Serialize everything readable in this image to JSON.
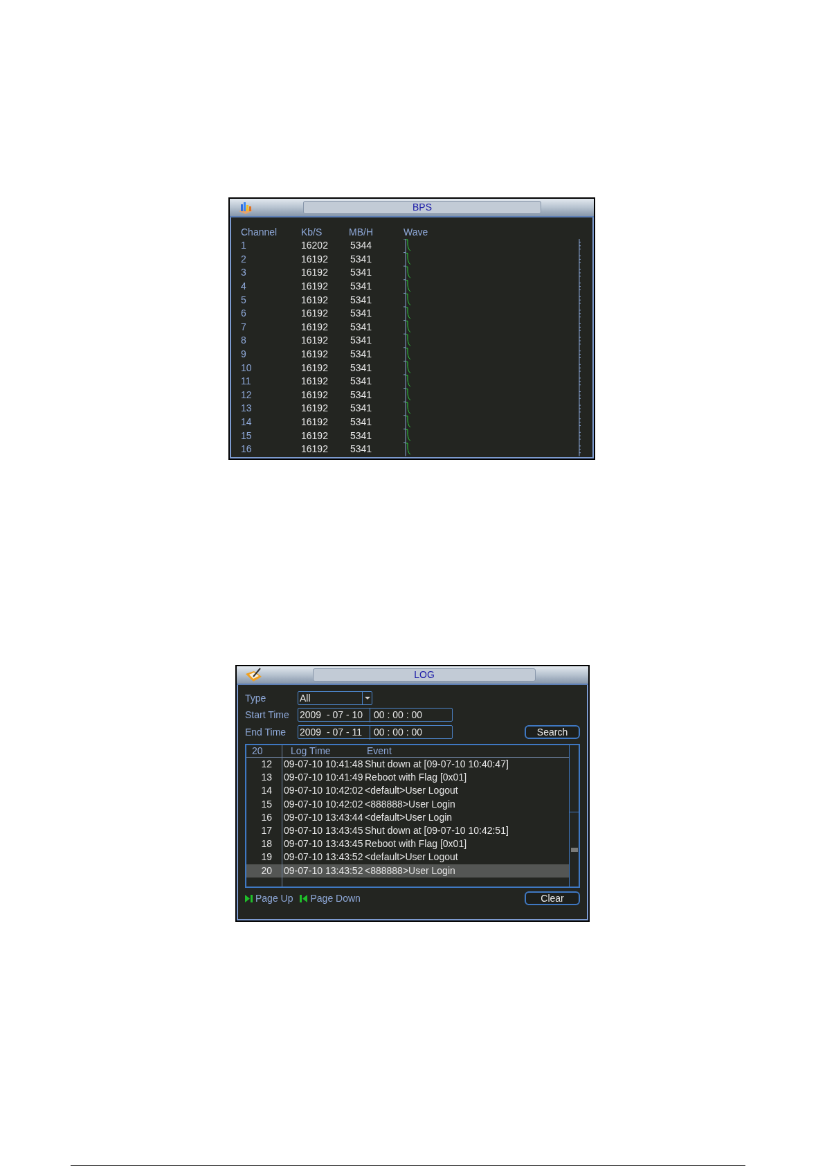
{
  "bps_window": {
    "title": "BPS",
    "columns": [
      "Channel",
      "Kb/S",
      "MB/H",
      "Wave"
    ],
    "rows": [
      {
        "channel": "1",
        "kbs": "16202",
        "mbh": "5344"
      },
      {
        "channel": "2",
        "kbs": "16192",
        "mbh": "5341"
      },
      {
        "channel": "3",
        "kbs": "16192",
        "mbh": "5341"
      },
      {
        "channel": "4",
        "kbs": "16192",
        "mbh": "5341"
      },
      {
        "channel": "5",
        "kbs": "16192",
        "mbh": "5341"
      },
      {
        "channel": "6",
        "kbs": "16192",
        "mbh": "5341"
      },
      {
        "channel": "7",
        "kbs": "16192",
        "mbh": "5341"
      },
      {
        "channel": "8",
        "kbs": "16192",
        "mbh": "5341"
      },
      {
        "channel": "9",
        "kbs": "16192",
        "mbh": "5341"
      },
      {
        "channel": "10",
        "kbs": "16192",
        "mbh": "5341"
      },
      {
        "channel": "11",
        "kbs": "16192",
        "mbh": "5341"
      },
      {
        "channel": "12",
        "kbs": "16192",
        "mbh": "5341"
      },
      {
        "channel": "13",
        "kbs": "16192",
        "mbh": "5341"
      },
      {
        "channel": "14",
        "kbs": "16192",
        "mbh": "5341"
      },
      {
        "channel": "15",
        "kbs": "16192",
        "mbh": "5341"
      },
      {
        "channel": "16",
        "kbs": "16192",
        "mbh": "5341"
      }
    ]
  },
  "log_window": {
    "title": "LOG",
    "type": {
      "label": "Type",
      "value": "All"
    },
    "start_time": {
      "label": "Start Time",
      "date": "2009  - 07 - 10",
      "time": "00 : 00 : 00"
    },
    "end_time": {
      "label": "End Time",
      "date": "2009  - 07 - 11",
      "time": "00 : 00 : 00"
    },
    "search_button": "Search",
    "table": {
      "count": "20",
      "columns": [
        "Log Time",
        "Event"
      ],
      "rows": [
        {
          "index": "12",
          "time": "09-07-10 10:41:48",
          "event": "Shut down at [09-07-10 10:40:47]",
          "selected": false
        },
        {
          "index": "13",
          "time": "09-07-10 10:41:49",
          "event": "Reboot with Flag [0x01]",
          "selected": false
        },
        {
          "index": "14",
          "time": "09-07-10 10:42:02",
          "event": "<default>User Logout",
          "selected": false
        },
        {
          "index": "15",
          "time": "09-07-10 10:42:02",
          "event": "<888888>User Login",
          "selected": false
        },
        {
          "index": "16",
          "time": "09-07-10 13:43:44",
          "event": "<default>User Login",
          "selected": false
        },
        {
          "index": "17",
          "time": "09-07-10 13:43:45",
          "event": "Shut down at [09-07-10 10:42:51]",
          "selected": false
        },
        {
          "index": "18",
          "time": "09-07-10 13:43:45",
          "event": "Reboot with Flag [0x01]",
          "selected": false
        },
        {
          "index": "19",
          "time": "09-07-10 13:43:52",
          "event": "<default>User Logout",
          "selected": false
        },
        {
          "index": "20",
          "time": "09-07-10 13:43:52",
          "event": "<888888>User Login",
          "selected": true
        }
      ]
    },
    "page_up": "Page Up",
    "page_down": "Page Down",
    "clear_button": "Clear"
  }
}
